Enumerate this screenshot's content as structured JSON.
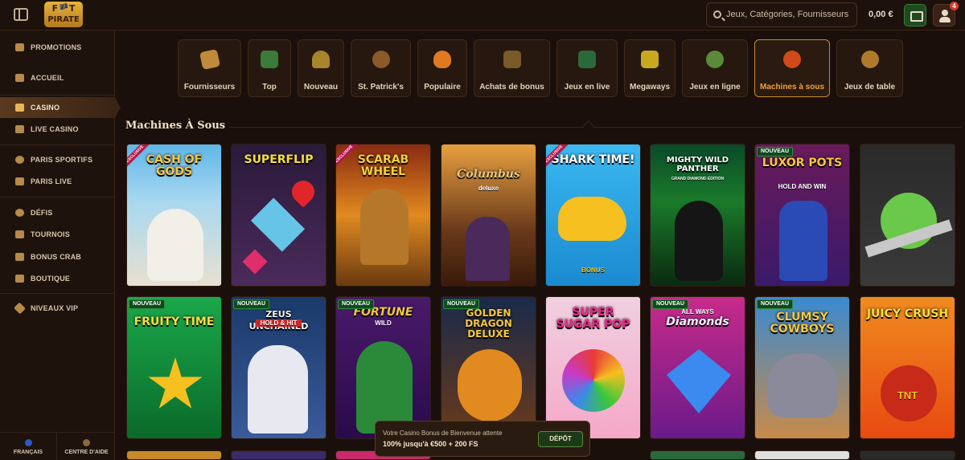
{
  "header": {
    "logo_line1": "F🏴T",
    "logo_line2": "PIRATE",
    "search_placeholder": "Jeux, Catégories, Fournisseurs",
    "balance": "0,00 €",
    "notification_count": "4"
  },
  "sidebar": {
    "items": [
      {
        "label": "PROMOTIONS"
      },
      {
        "label": "ACCUEIL"
      },
      {
        "label": "CASINO"
      },
      {
        "label": "LIVE CASINO"
      },
      {
        "label": "PARIS SPORTIFS"
      },
      {
        "label": "PARIS LIVE"
      },
      {
        "label": "DÉFIS"
      },
      {
        "label": "TOURNOIS"
      },
      {
        "label": "BONUS CRAB"
      },
      {
        "label": "BOUTIQUE"
      },
      {
        "label": "NIVEAUX VIP"
      }
    ],
    "footer": {
      "language": "FRANÇAIS",
      "help": "CENTRE D'AIDE"
    }
  },
  "categories": [
    {
      "label": "Fournisseurs"
    },
    {
      "label": "Top"
    },
    {
      "label": "Nouveau"
    },
    {
      "label": "St. Patrick's"
    },
    {
      "label": "Populaire"
    },
    {
      "label": "Achats de bonus"
    },
    {
      "label": "Jeux en live"
    },
    {
      "label": "Megaways"
    },
    {
      "label": "Jeux en ligne"
    },
    {
      "label": "Machines à sous"
    },
    {
      "label": "Jeux de table"
    }
  ],
  "section_title": "Machines À Sous",
  "games_row1": [
    {
      "title": "CASH OF GODS",
      "badge": "EXCLUSIVE"
    },
    {
      "title": "SUPERFLIP",
      "badge": ""
    },
    {
      "title": "SCARAB WHEEL",
      "badge": "EXCLUSIVE"
    },
    {
      "title": "Columbus",
      "sub": "deluxe",
      "badge": ""
    },
    {
      "title": "SHARK TIME!",
      "sub": "BONUS",
      "badge": "EXCLUSIVE"
    },
    {
      "title": "MIGHTY WILD PANTHER",
      "sub": "GRAND DIAMOND EDITION",
      "badge": ""
    },
    {
      "title": "LUXOR POTS",
      "sub": "HOLD AND WIN",
      "badge": "NOUVEAU"
    },
    {
      "title": "",
      "badge": ""
    }
  ],
  "games_row2": [
    {
      "title": "FRUITY TIME",
      "badge": "NOUVEAU"
    },
    {
      "title": "ZEUS UNCHAINED",
      "sub": "HOLD & HIT",
      "badge": "NOUVEAU"
    },
    {
      "title": "FORTUNE",
      "sub": "WILD",
      "badge": "NOUVEAU"
    },
    {
      "title": "GOLDEN DRAGON DELUXE",
      "badge": "NOUVEAU"
    },
    {
      "title": "SUPER SUGAR POP",
      "badge": ""
    },
    {
      "title": "Diamonds",
      "sub": "ALL WAYS",
      "badge": "NOUVEAU"
    },
    {
      "title": "CLUMSY COWBOYS",
      "badge": "NOUVEAU"
    },
    {
      "title": "JUICY CRUSH",
      "sub": "TNT",
      "badge": ""
    }
  ],
  "promo": {
    "line1": "Votre Casino Bonus de Bienvenue attente",
    "line2": "100% jusqu'à €500 + 200 FS",
    "button": "DÉPÔT"
  }
}
